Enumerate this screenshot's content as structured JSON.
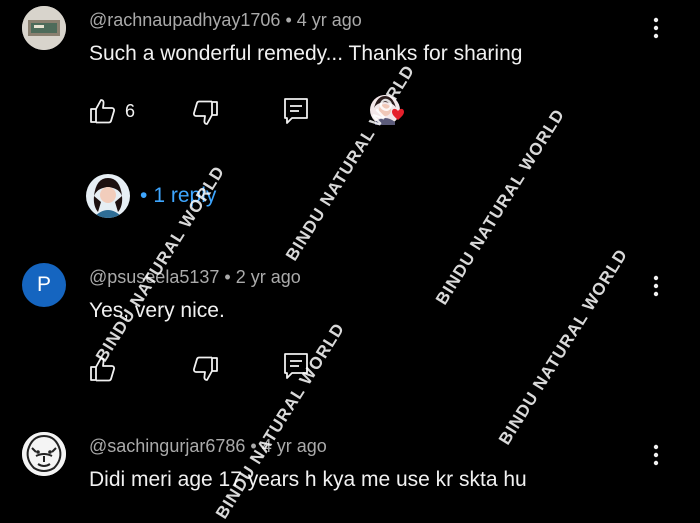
{
  "comments": [
    {
      "author": "@rachnaupadhyay1706",
      "age": "4 yr ago",
      "text": "Such a wonderful remedy... Thanks for sharing",
      "likes": "6",
      "avatar_type": "photo"
    },
    {
      "author": "@psuseela5137",
      "age": "2 yr ago",
      "text": "Yes, very nice.",
      "avatar_letter": "P",
      "avatar_color": "#1565c0"
    },
    {
      "author": "@sachingurjar6786",
      "age": "4 yr ago",
      "text": "Didi meri age 17 years  h kya me use kr skta hu",
      "avatar_type": "lion-sketch"
    }
  ],
  "reply": {
    "label": "1 reply",
    "bullet": "•"
  },
  "separator": "•",
  "watermark": "BINDU NATURAL WORLD",
  "colors": {
    "background": "#000000",
    "text": "#f1f1f1",
    "meta": "#aaaaaa",
    "link": "#3ea6ff",
    "heart": "#e5202b"
  }
}
